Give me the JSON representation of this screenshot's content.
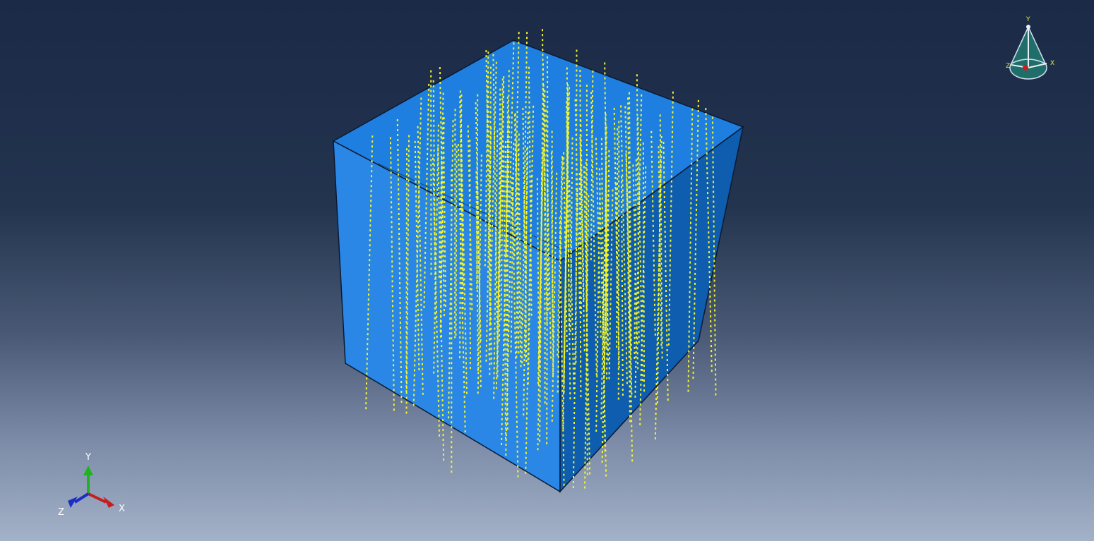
{
  "viewport": {
    "background_top": "#1b2a47",
    "background_bottom": "#a3b2c8"
  },
  "model": {
    "type": "solid-cube-with-embedded-fibers",
    "face_colors": {
      "top": "#1f7fe0",
      "front": "#2b87e6",
      "side": "#0d5aa8"
    },
    "edge_color": "#0a1a33",
    "fiber_color": "#f4f52a"
  },
  "triad": {
    "x_label": "X",
    "y_label": "Y",
    "z_label": "Z",
    "x_color": "#c41e1e",
    "y_color": "#1eb41e",
    "z_color": "#1e2ec4"
  },
  "view_cube": {
    "x_label": "X",
    "y_label": "Y",
    "z_label": "Z",
    "label_color": "#e8e84a",
    "face_color": "#1f6e6a",
    "origin_color": "#c82020"
  }
}
